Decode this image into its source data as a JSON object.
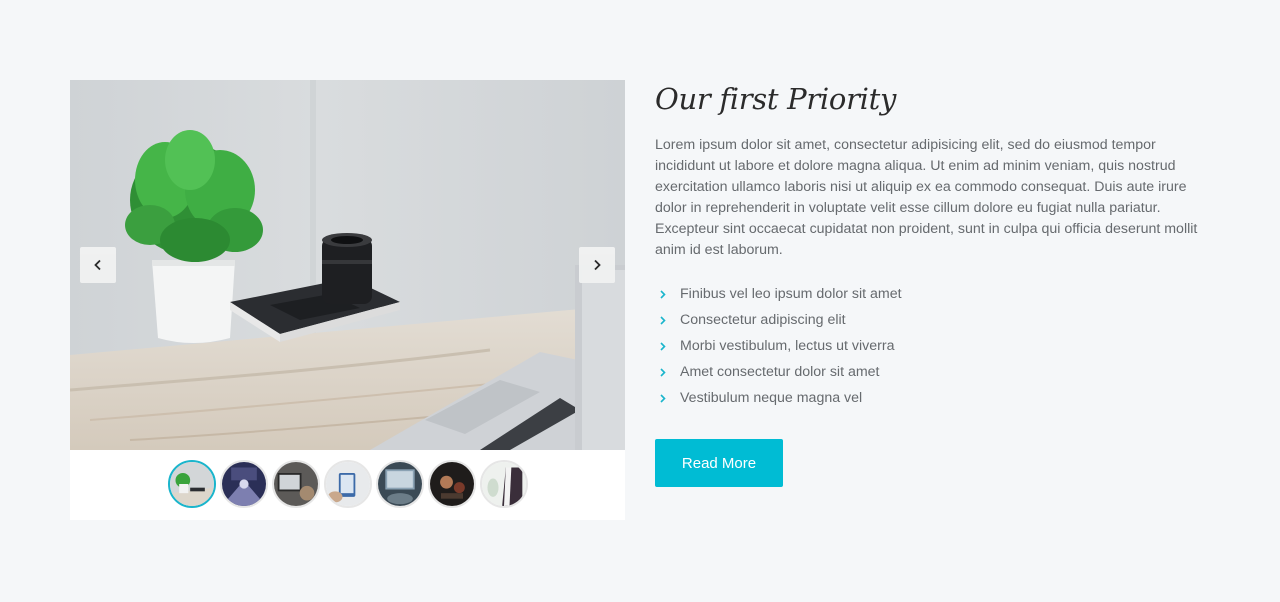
{
  "slider": {
    "prev_icon": "chevron-left-icon",
    "next_icon": "chevron-right-icon",
    "active_index": 0,
    "thumbnail_count": 7
  },
  "content": {
    "title": "Our first Priority",
    "paragraph": "Lorem ipsum dolor sit amet, consectetur adipisicing elit, sed do eiusmod tempor incididunt ut labore et dolore magna aliqua. Ut enim ad minim veniam, quis nostrud exercitation ullamco laboris nisi ut aliquip ex ea commodo consequat. Duis aute irure dolor in reprehenderit in voluptate velit esse cillum dolore eu fugiat nulla pariatur. Excepteur sint occaecat cupidatat non proident, sunt in culpa qui officia deserunt mollit anim id est laborum.",
    "features": [
      "Finibus vel leo ipsum dolor sit amet",
      "Consectetur adipiscing elit",
      "Morbi vestibulum, lectus ut viverra",
      "Amet consectetur dolor sit amet",
      "Vestibulum neque magna vel"
    ],
    "button_label": "Read More"
  },
  "colors": {
    "accent": "#00bcd4",
    "background": "#f5f7f9",
    "text": "#666a6e",
    "heading": "#2b2b2b"
  }
}
